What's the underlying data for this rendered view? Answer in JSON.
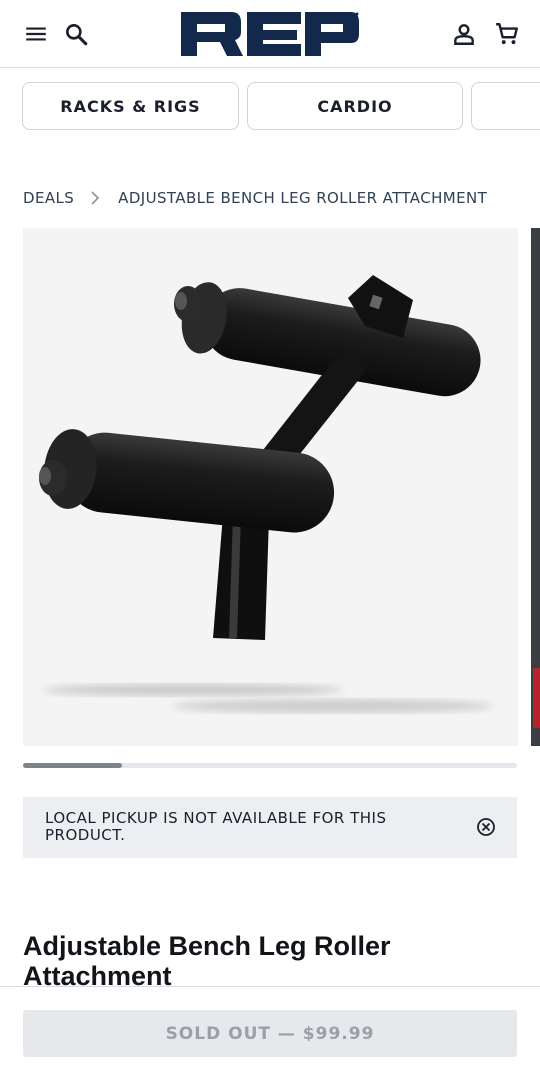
{
  "header": {
    "brand": "REP",
    "icons": [
      "menu-icon",
      "search-icon",
      "account-icon",
      "cart-icon"
    ]
  },
  "categories": [
    {
      "label": "RACKS & RIGS"
    },
    {
      "label": "CARDIO"
    },
    {
      "label": ""
    }
  ],
  "breadcrumb": {
    "parent": "DEALS",
    "current": "ADJUSTABLE BENCH LEG ROLLER ATTACHMENT"
  },
  "gallery": {
    "image_count_visible": 2,
    "scroll_progress": 0.2
  },
  "notice": {
    "text": "LOCAL PICKUP IS NOT AVAILABLE FOR THIS PRODUCT."
  },
  "product": {
    "title": "Adjustable Bench Leg Roller Attachment"
  },
  "cta": {
    "label": "SOLD OUT — $99.99"
  },
  "colors": {
    "brand_navy": "#13294b",
    "text_dark": "#1a1f2b",
    "notice_bg": "#eceef2",
    "disabled_bg": "#e6e8ec",
    "disabled_text": "#9aa0a8"
  }
}
